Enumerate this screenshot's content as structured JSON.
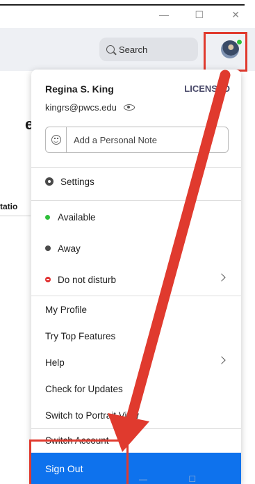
{
  "window": {
    "minimize_glyph": "—",
    "maximize_glyph": "☐",
    "close_glyph": "✕"
  },
  "toolbar": {
    "search_label": "Search",
    "search_icon": "search-icon",
    "presence_color": "#2fbf3a"
  },
  "background": {
    "title_fragment": "eet",
    "column_fragment": "tatio"
  },
  "menu": {
    "user_name": "Regina S. King",
    "license": "LICENSED",
    "email": "kingrs@pwcs.edu",
    "personal_note_placeholder": "Add a Personal Note",
    "settings": "Settings",
    "status": {
      "available": "Available",
      "away": "Away",
      "do_not_disturb": "Do not disturb"
    },
    "links": {
      "my_profile": "My Profile",
      "try_top_features": "Try Top Features",
      "help": "Help",
      "check_for_updates": "Check for Updates",
      "switch_to_portrait": "Switch to Portrait View",
      "switch_account": "Switch Account",
      "sign_out": "Sign Out"
    },
    "colors": {
      "available": "#2fbf3a",
      "away": "#4a4a4a",
      "dnd": "#e02e2e",
      "sign_out_bg": "#0e72ed",
      "annotation": "#e03a2e"
    }
  },
  "ghost_controls": "— ☐ ✕"
}
